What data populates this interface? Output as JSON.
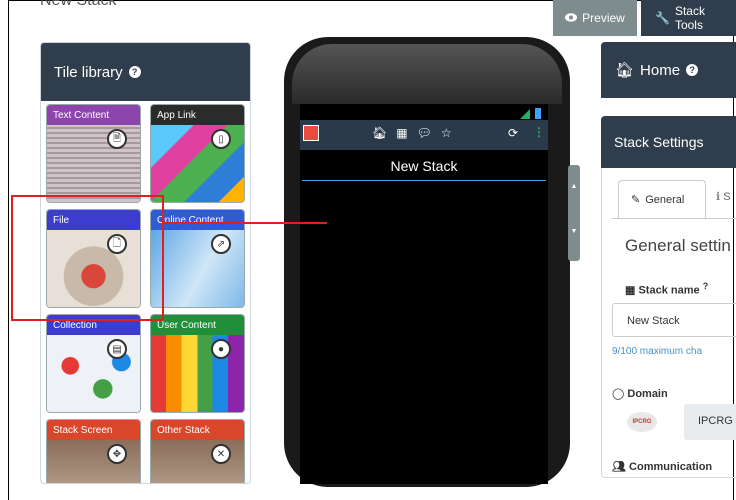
{
  "page": {
    "title": "New Stack"
  },
  "top_tabs": {
    "preview": "Preview",
    "stack_tools": "Stack Tools"
  },
  "library": {
    "title": "Tile library",
    "tiles": [
      {
        "label": "Text Content",
        "color": "#8e44ad",
        "icon": "file-text-icon",
        "glyph": "🗎"
      },
      {
        "label": "App Link",
        "color": "#2b2b2b",
        "icon": "mobile-icon",
        "glyph": "▯"
      },
      {
        "label": "File",
        "color": "#3c3ccf",
        "icon": "file-icon",
        "glyph": "🗋"
      },
      {
        "label": "Online Content",
        "color": "#2e5bd6",
        "icon": "external-link-icon",
        "glyph": "⇗"
      },
      {
        "label": "Collection",
        "color": "#3c3ccf",
        "icon": "list-icon",
        "glyph": "▤"
      },
      {
        "label": "User Content",
        "color": "#1f8f3a",
        "icon": "user-icon",
        "glyph": "●"
      },
      {
        "label": "Stack Screen",
        "color": "#d9472b",
        "icon": "move-icon",
        "glyph": "✥"
      },
      {
        "label": "Other Stack",
        "color": "#d9472b",
        "icon": "shuffle-icon",
        "glyph": "✕"
      }
    ]
  },
  "phone": {
    "app_title": "New Stack",
    "toolbar_icons": [
      "home-icon",
      "grid-icon",
      "chat-icon",
      "star-icon",
      "refresh-icon",
      "more-icon"
    ],
    "colors": {
      "bar": "#2b3a4a",
      "accent": "#4aa3df"
    }
  },
  "right": {
    "home_title": "Home",
    "settings_title": "Stack Settings",
    "tab_general": "General",
    "tab_second": "S",
    "general_title": "General settin",
    "stack_name_label": "Stack name",
    "stack_name_value": "New Stack",
    "stack_name_hint": "9/100 maximum cha",
    "domain_label": "Domain",
    "domain_logo_text": "IPCRG",
    "domain_value": "IPCRG",
    "communication_label": "Communication"
  },
  "annotation": {
    "color": "#e02020"
  }
}
